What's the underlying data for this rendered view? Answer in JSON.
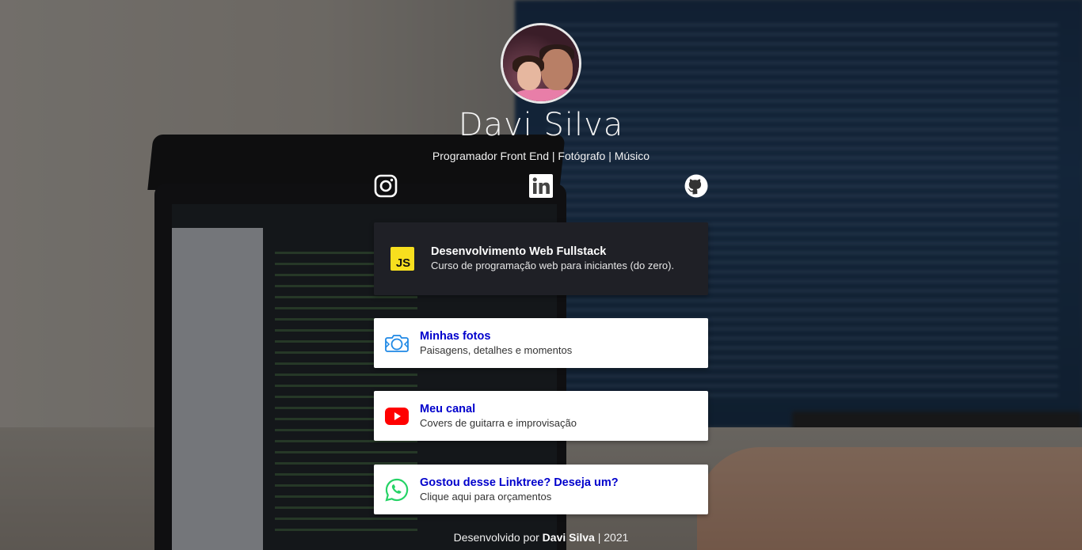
{
  "profile": {
    "name": "Davi Silva",
    "bio": "Programador Front End | Fotógrafo | Músico"
  },
  "social": [
    {
      "name": "instagram",
      "icon": "instagram-icon"
    },
    {
      "name": "linkedin",
      "icon": "linkedin-icon"
    },
    {
      "name": "github",
      "icon": "github-icon"
    }
  ],
  "links": [
    {
      "title": "Desenvolvimento Web Fullstack",
      "subtitle": "Curso de programação web para iniciantes (do zero).",
      "icon": "javascript-icon",
      "icon_label": "JS",
      "style": "dark"
    },
    {
      "title": "Minhas fotos",
      "subtitle": "Paisagens, detalhes e momentos",
      "icon": "camera-icon",
      "style": "light"
    },
    {
      "title": "Meu canal",
      "subtitle": "Covers de guitarra e improvisação",
      "icon": "youtube-icon",
      "style": "light"
    },
    {
      "title": "Gostou desse Linktree? Deseja um?",
      "subtitle": "Clique aqui para orçamentos",
      "icon": "whatsapp-icon",
      "style": "light"
    }
  ],
  "footer": {
    "prefix": "Desenvolvido por",
    "author": "Davi Silva",
    "suffix": "| 2021"
  },
  "colors": {
    "link_title": "#0000cc",
    "dark_card": "#1f2026",
    "js_yellow": "#f7df1e",
    "youtube_red": "#ff0000",
    "whatsapp_green": "#25d366",
    "camera_blue": "#1e88e5"
  }
}
